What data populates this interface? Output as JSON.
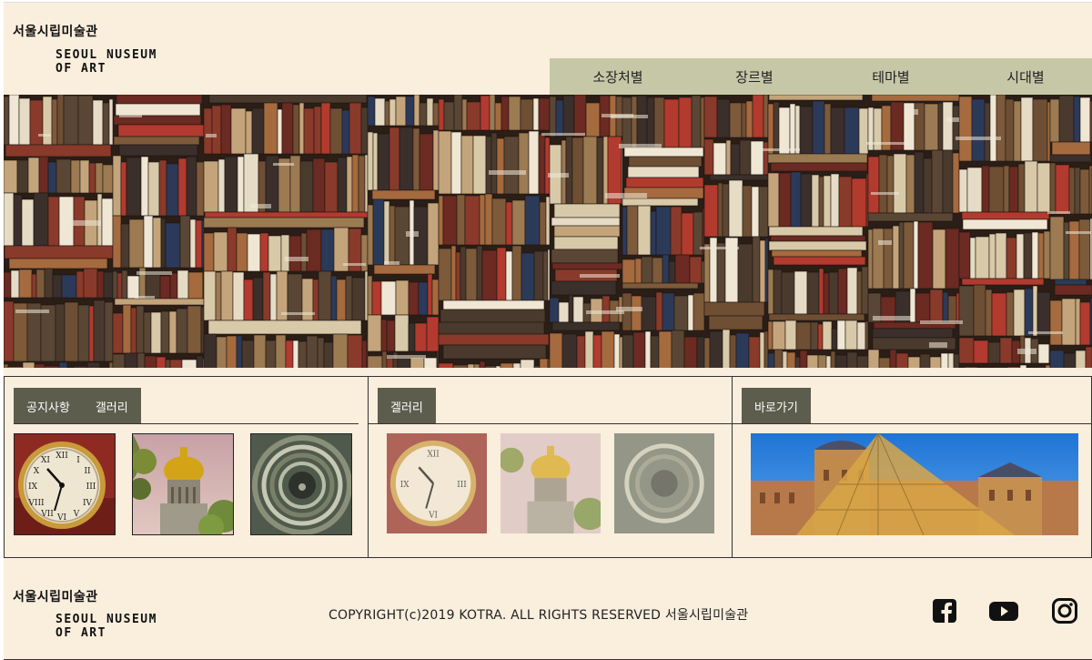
{
  "header": {
    "logo_korean": "서울시립미술관",
    "logo_english": "SEOUL NUSEUM\nOF ART",
    "nav": [
      "소장처별",
      "장르별",
      "테마별",
      "시대별"
    ]
  },
  "hero": {
    "icon": "stacked-books-image"
  },
  "panels": {
    "notice": {
      "tabs": [
        "공지사항",
        "갤러리"
      ],
      "thumbnails": [
        "clock-image",
        "cathedral-dome-image",
        "spiral-staircase-image"
      ]
    },
    "gallery": {
      "tab": "겔러리",
      "thumbnails": [
        "clock-image",
        "cathedral-dome-image",
        "spiral-staircase-image"
      ]
    },
    "shortcut": {
      "tab": "바로가기",
      "banner": "louvre-pyramid-image"
    }
  },
  "footer": {
    "logo_korean": "서울시립미술관",
    "logo_english": "SEOUL NUSEUM\nOF ART",
    "copyright": "COPYRIGHT(c)2019 KOTRA. ALL RIGHTS RESERVED 서울시립미술관",
    "social": [
      "facebook-icon",
      "youtube-icon",
      "instagram-icon"
    ]
  },
  "colors": {
    "page_background": "#faeedd",
    "nav_background": "#c6c7a7",
    "tab_background": "#5c5d4c"
  }
}
